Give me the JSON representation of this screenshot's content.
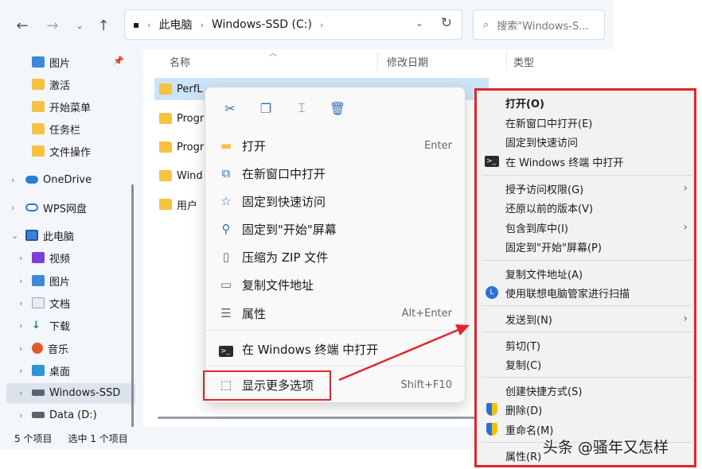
{
  "toolbar": {
    "back_icon": "back-arrow-icon",
    "forward_icon": "forward-arrow-icon",
    "recent_icon": "chevron-down-icon",
    "up_icon": "up-arrow-icon",
    "address": {
      "crumbs": [
        "此电脑",
        "Windows-SSD (C:)"
      ]
    },
    "search_placeholder": "搜索\"Windows-S..."
  },
  "sidebar": {
    "quick": [
      {
        "label": "图片",
        "icon": "pictures-icon",
        "pinned": true
      },
      {
        "label": "激活",
        "icon": "folder-icon"
      },
      {
        "label": "开始菜单",
        "icon": "folder-icon"
      },
      {
        "label": "任务栏",
        "icon": "folder-icon"
      },
      {
        "label": "文件操作",
        "icon": "folder-icon"
      }
    ],
    "onedrive": "OneDrive",
    "wps": "WPS网盘",
    "thispc": "此电脑",
    "pc_items": [
      {
        "label": "视频",
        "icon": "video-icon"
      },
      {
        "label": "图片",
        "icon": "pictures-icon"
      },
      {
        "label": "文档",
        "icon": "documents-icon"
      },
      {
        "label": "下载",
        "icon": "download-icon"
      },
      {
        "label": "音乐",
        "icon": "music-icon"
      },
      {
        "label": "桌面",
        "icon": "desktop-icon"
      },
      {
        "label": "Windows-SSD",
        "icon": "drive-icon"
      },
      {
        "label": "Data (D:)",
        "icon": "drive-icon"
      }
    ]
  },
  "main": {
    "columns": [
      "名称",
      "修改日期",
      "类型"
    ],
    "rows": [
      {
        "label": "PerfL"
      },
      {
        "label": "Progr"
      },
      {
        "label": "Progr"
      },
      {
        "label": "Wind"
      },
      {
        "label": "用户"
      }
    ]
  },
  "status": {
    "count": "5 个项目",
    "selected": "选中 1 个项目"
  },
  "context_menu": {
    "quick_actions": [
      {
        "name": "cut",
        "icon": "scissors-icon"
      },
      {
        "name": "copy",
        "icon": "copy-icon"
      },
      {
        "name": "rename",
        "icon": "rename-icon"
      },
      {
        "name": "delete",
        "icon": "trash-icon"
      }
    ],
    "items": [
      {
        "label": "打开",
        "shortcut": "Enter"
      },
      {
        "label": "在新窗口中打开",
        "shortcut": ""
      },
      {
        "label": "固定到快速访问",
        "shortcut": ""
      },
      {
        "label": "固定到\"开始\"屏幕",
        "shortcut": ""
      },
      {
        "label": "压缩为 ZIP 文件",
        "shortcut": ""
      },
      {
        "label": "复制文件地址",
        "shortcut": ""
      },
      {
        "label": "属性",
        "shortcut": "Alt+Enter"
      }
    ],
    "terminal": "在 Windows 终端 中打开",
    "more": {
      "label": "显示更多选项",
      "shortcut": "Shift+F10"
    }
  },
  "classic_menu": {
    "group1": [
      {
        "label": "打开(O)",
        "bold": true
      },
      {
        "label": "在新窗口中打开(E)"
      },
      {
        "label": "固定到快速访问"
      },
      {
        "label": "在 Windows 终端 中打开",
        "icon": "terminal-icon"
      }
    ],
    "group2": [
      {
        "label": "授予访问权限(G)",
        "submenu": true
      },
      {
        "label": "还原以前的版本(V)"
      },
      {
        "label": "包含到库中(I)",
        "submenu": true
      },
      {
        "label": "固定到\"开始\"屏幕(P)"
      }
    ],
    "group3": [
      {
        "label": "复制文件地址(A)"
      },
      {
        "label": "使用联想电脑管家进行扫描",
        "icon": "lenovo-icon"
      }
    ],
    "group4": [
      {
        "label": "发送到(N)",
        "submenu": true
      }
    ],
    "group5": [
      {
        "label": "剪切(T)"
      },
      {
        "label": "复制(C)"
      }
    ],
    "group6": [
      {
        "label": "创建快捷方式(S)"
      },
      {
        "label": "删除(D)",
        "icon": "shield-icon"
      },
      {
        "label": "重命名(M)",
        "icon": "shield-icon"
      }
    ],
    "group7": [
      {
        "label": "属性(R)"
      }
    ]
  },
  "watermark": "头条 @骚年又怎样",
  "colors": {
    "highlight": "#e0262c",
    "selection": "#cce4f7",
    "folder": "#f5c242"
  }
}
